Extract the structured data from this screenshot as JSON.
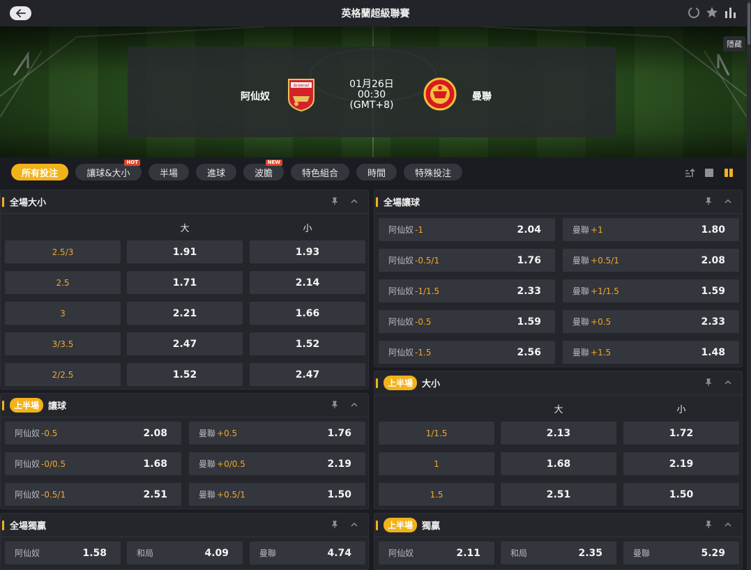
{
  "header": {
    "title": "英格蘭超級聯賽",
    "hide_label": "隱藏"
  },
  "match": {
    "home": "阿仙奴",
    "away": "曼聯",
    "date": "01月26日",
    "time": "00:30",
    "tz": "(GMT+8)",
    "home_crest_text": "Arsenal"
  },
  "tabs": [
    {
      "label": "所有投注",
      "active": true
    },
    {
      "label": "讓球&大小",
      "tag": "HOT"
    },
    {
      "label": "半場"
    },
    {
      "label": "進球"
    },
    {
      "label": "波膽",
      "tag": "NEW"
    },
    {
      "label": "特色組合"
    },
    {
      "label": "時間"
    },
    {
      "label": "特殊投注"
    }
  ],
  "ft_ou": {
    "title": "全場大小",
    "over": "大",
    "under": "小",
    "rows": [
      {
        "line": "2.5/3",
        "over": "1.91",
        "under": "1.93"
      },
      {
        "line": "2.5",
        "over": "1.71",
        "under": "2.14"
      },
      {
        "line": "3",
        "over": "2.21",
        "under": "1.66"
      },
      {
        "line": "3/3.5",
        "over": "2.47",
        "under": "1.52"
      },
      {
        "line": "2/2.5",
        "over": "1.52",
        "under": "2.47"
      }
    ]
  },
  "ft_hdp": {
    "title": "全場讓球",
    "rows": [
      {
        "home": "阿仙奴",
        "hline": "-1",
        "hodds": "2.04",
        "away": "曼聯",
        "aline": "+1",
        "aodds": "1.80"
      },
      {
        "home": "阿仙奴",
        "hline": "-0.5/1",
        "hodds": "1.76",
        "away": "曼聯",
        "aline": "+0.5/1",
        "aodds": "2.08"
      },
      {
        "home": "阿仙奴",
        "hline": "-1/1.5",
        "hodds": "2.33",
        "away": "曼聯",
        "aline": "+1/1.5",
        "aodds": "1.59"
      },
      {
        "home": "阿仙奴",
        "hline": "-0.5",
        "hodds": "1.59",
        "away": "曼聯",
        "aline": "+0.5",
        "aodds": "2.33"
      },
      {
        "home": "阿仙奴",
        "hline": "-1.5",
        "hodds": "2.56",
        "away": "曼聯",
        "aline": "+1.5",
        "aodds": "1.48"
      }
    ]
  },
  "ht_hdp": {
    "badge": "上半場",
    "title": "讓球",
    "rows": [
      {
        "home": "阿仙奴",
        "hline": "-0.5",
        "hodds": "2.08",
        "away": "曼聯",
        "aline": "+0.5",
        "aodds": "1.76"
      },
      {
        "home": "阿仙奴",
        "hline": "-0/0.5",
        "hodds": "1.68",
        "away": "曼聯",
        "aline": "+0/0.5",
        "aodds": "2.19"
      },
      {
        "home": "阿仙奴",
        "hline": "-0.5/1",
        "hodds": "2.51",
        "away": "曼聯",
        "aline": "+0.5/1",
        "aodds": "1.50"
      }
    ]
  },
  "ht_ou": {
    "badge": "上半場",
    "title": "大小",
    "over": "大",
    "under": "小",
    "rows": [
      {
        "line": "1/1.5",
        "over": "2.13",
        "under": "1.72"
      },
      {
        "line": "1",
        "over": "1.68",
        "under": "2.19"
      },
      {
        "line": "1.5",
        "over": "2.51",
        "under": "1.50"
      }
    ]
  },
  "ft_1x2": {
    "title": "全場獨贏",
    "home": "阿仙奴",
    "home_odds": "1.58",
    "draw": "和局",
    "draw_odds": "4.09",
    "away": "曼聯",
    "away_odds": "4.74"
  },
  "ht_1x2": {
    "badge": "上半場",
    "title": "獨贏",
    "home": "阿仙奴",
    "home_odds": "2.11",
    "draw": "和局",
    "draw_odds": "2.35",
    "away": "曼聯",
    "away_odds": "5.29"
  },
  "colors": {
    "accent": "#f2b21a",
    "line": "#f2a82a",
    "cell": "#34363d",
    "panel": "#25262c"
  }
}
